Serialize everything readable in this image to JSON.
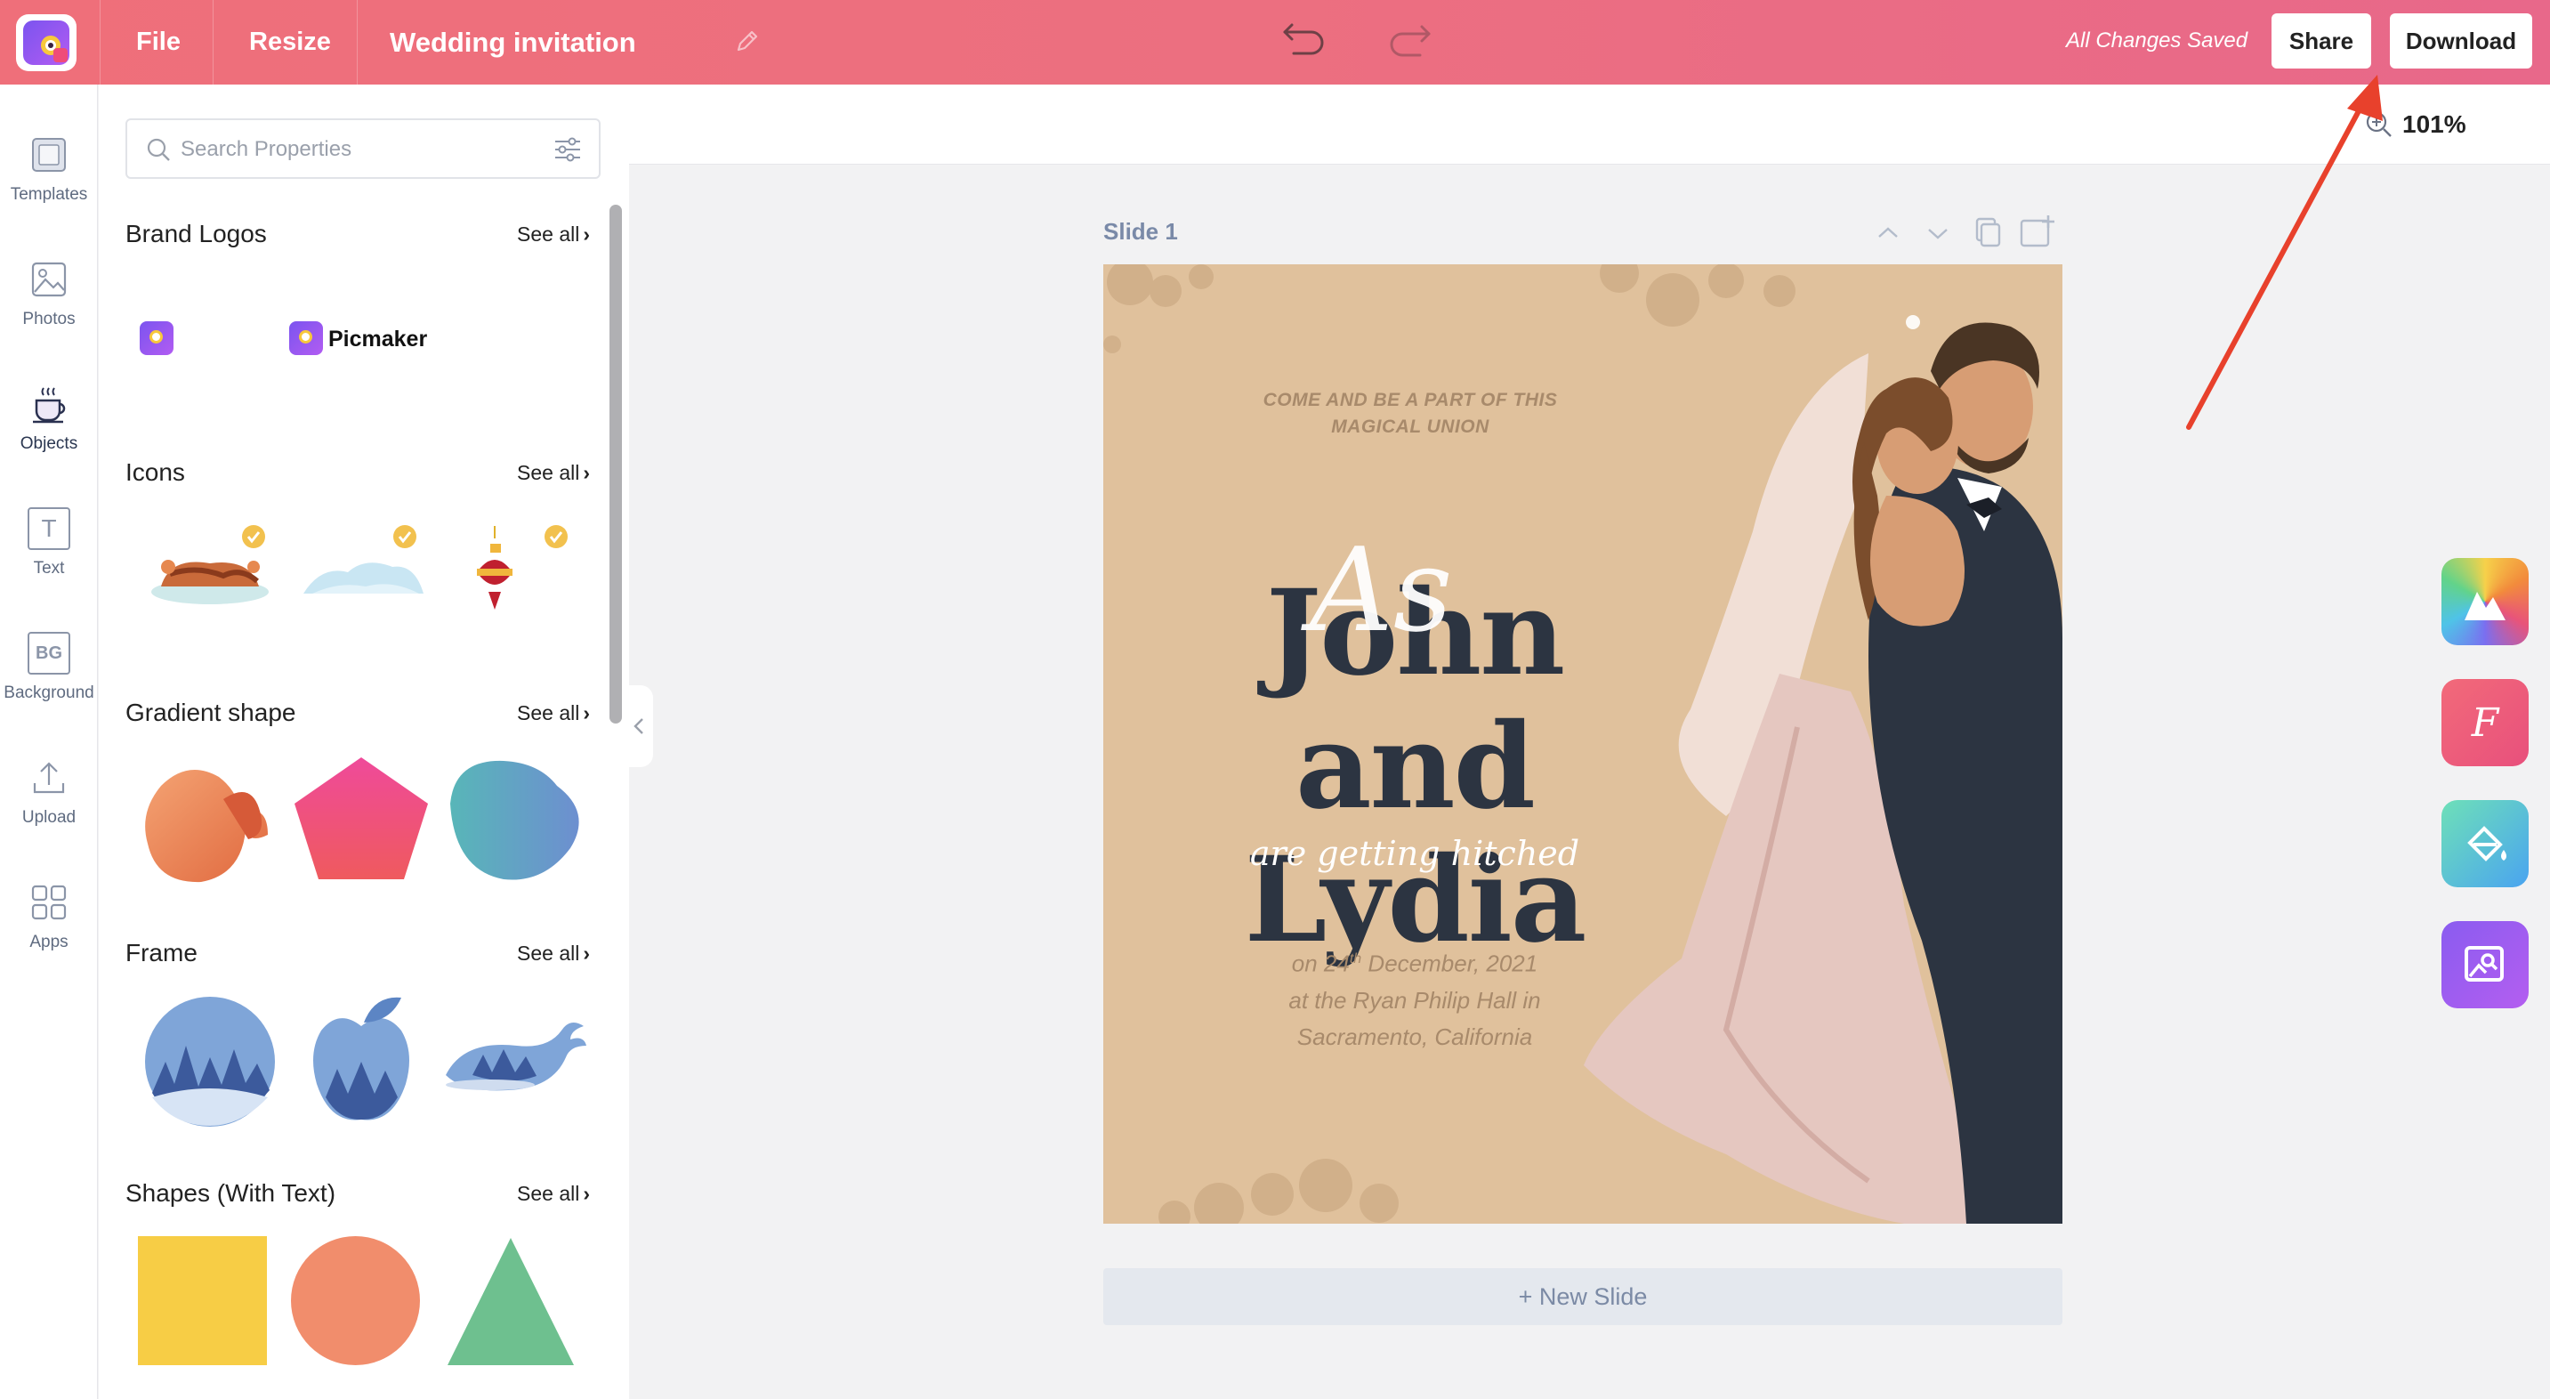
{
  "topbar": {
    "file_label": "File",
    "resize_label": "Resize",
    "doc_title": "Wedding invitation",
    "save_status": "All Changes Saved",
    "share_label": "Share",
    "download_label": "Download"
  },
  "rail": {
    "items": [
      {
        "label": "Templates",
        "icon": "templates-icon"
      },
      {
        "label": "Photos",
        "icon": "photos-icon"
      },
      {
        "label": "Objects",
        "icon": "objects-icon"
      },
      {
        "label": "Text",
        "icon": "text-icon"
      },
      {
        "label": "Background",
        "icon": "background-icon"
      },
      {
        "label": "Upload",
        "icon": "upload-icon"
      },
      {
        "label": "Apps",
        "icon": "apps-icon"
      }
    ],
    "bg_icon_text": "BG",
    "text_icon_text": "T"
  },
  "panel": {
    "search_placeholder": "Search Properties",
    "see_all_label": "See all",
    "sections": [
      {
        "title": "Brand Logos"
      },
      {
        "title": "Icons"
      },
      {
        "title": "Gradient shape"
      },
      {
        "title": "Frame"
      },
      {
        "title": "Shapes (With Text)"
      }
    ],
    "brand_logo_text": "Picmaker"
  },
  "canvas": {
    "zoom": "101%",
    "slide_label": "Slide 1",
    "new_slide_label": "+ New Slide"
  },
  "invitation": {
    "top_line_1": "COME AND BE A PART OF THIS",
    "top_line_2": "MAGICAL UNION",
    "script_as": "As",
    "name_line_1": "John and",
    "name_line_2": "Lydia",
    "subtitle": "are getting hitched",
    "date_prefix": "on 24",
    "date_sup": "th",
    "date_suffix": "December, 2021",
    "venue_line": "at the Ryan Philip Hall in",
    "city_line": "Sacramento, California"
  },
  "colors": {
    "topbar_gradient_start": "#ef6f7a",
    "topbar_gradient_end": "#e8688a",
    "slide_background": "#e0c19c",
    "names_text": "#2c3441",
    "annotation_arrow": "#e8412c"
  }
}
